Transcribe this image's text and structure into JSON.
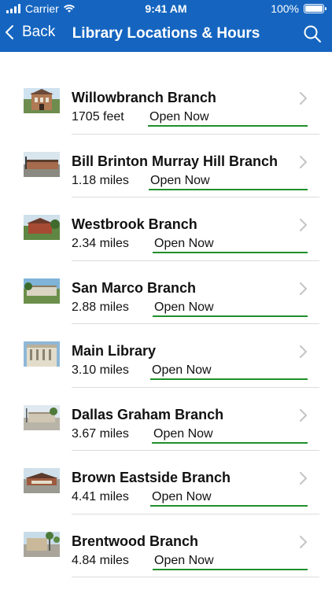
{
  "status_bar": {
    "carrier": "Carrier",
    "time": "9:41 AM",
    "battery": "100%"
  },
  "nav": {
    "back_label": "Back",
    "title": "Library Locations & Hours"
  },
  "colors": {
    "nav_blue": "#1565c0",
    "open_underline": "#1e8f2b"
  },
  "locations": [
    {
      "name": "Willowbranch Branch",
      "distance": "1705 feet",
      "status": "Open Now"
    },
    {
      "name": "Bill Brinton Murray Hill Branch",
      "distance": "1.18 miles",
      "status": "Open Now"
    },
    {
      "name": "Westbrook Branch",
      "distance": "2.34 miles",
      "status": "Open Now"
    },
    {
      "name": "San Marco Branch",
      "distance": "2.88 miles",
      "status": "Open Now"
    },
    {
      "name": "Main Library",
      "distance": "3.10 miles",
      "status": "Open Now"
    },
    {
      "name": "Dallas Graham Branch",
      "distance": "3.67 miles",
      "status": "Open Now"
    },
    {
      "name": "Brown Eastside Branch",
      "distance": "4.41 miles",
      "status": "Open Now"
    },
    {
      "name": "Brentwood Branch",
      "distance": "4.84 miles",
      "status": "Open Now"
    }
  ]
}
